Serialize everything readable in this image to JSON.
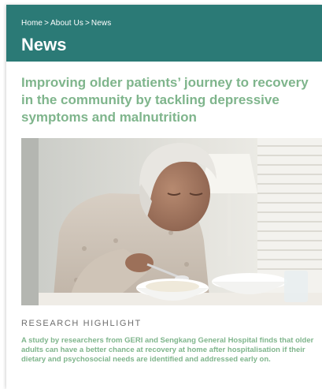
{
  "breadcrumb": {
    "items": [
      "Home",
      "About Us",
      "News"
    ],
    "separator": ">"
  },
  "page": {
    "title": "News"
  },
  "article": {
    "title": "Improving older patients’ journey to recovery in the community by tackling depressive symptoms and malnutrition",
    "category": "RESEARCH HIGHLIGHT",
    "summary": "A study by researchers from GERI and Sengkang General Hospital finds that older adults can have a better chance at recovery at home after hospitalisation if their dietary and psychosocial needs are identified and addressed early on."
  },
  "colors": {
    "header_bg": "#2b7a76",
    "accent_green": "#7fb58c",
    "category_text": "#6e6e6e"
  }
}
